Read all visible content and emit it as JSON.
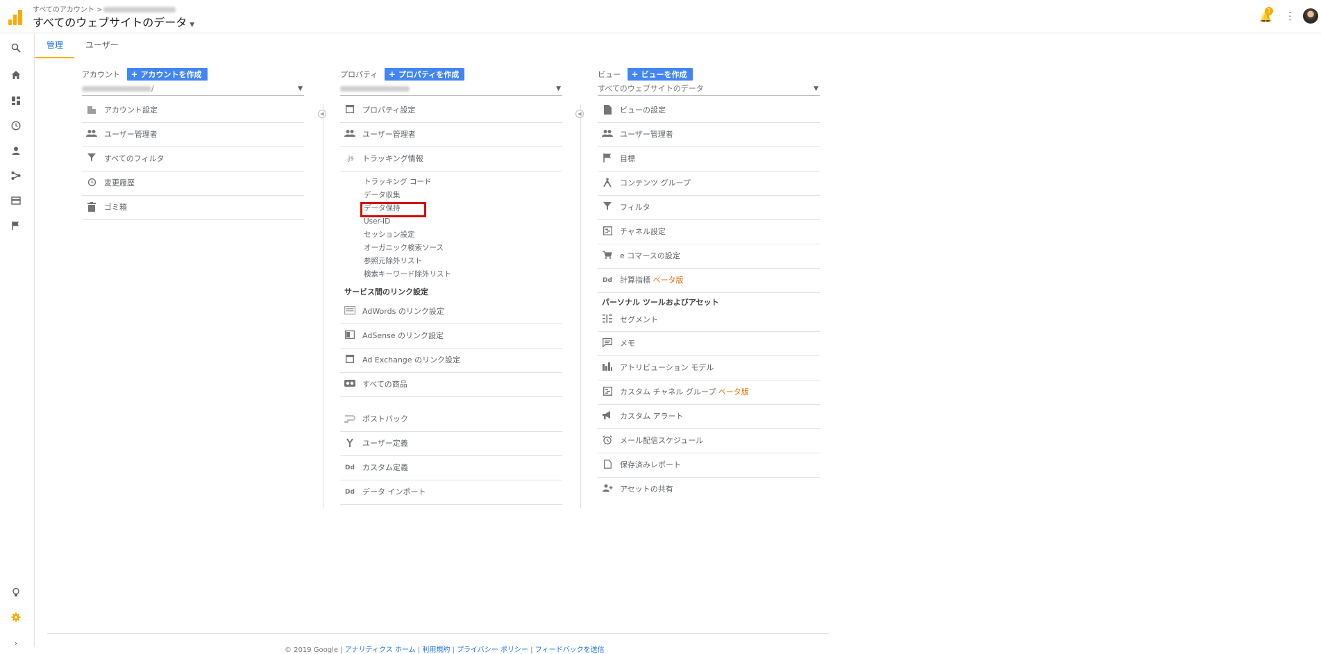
{
  "header": {
    "breadcrumb": "すべてのアカウント >",
    "view_title": "すべてのウェブサイトのデータ",
    "notification_count": "1"
  },
  "tabs": [
    {
      "label": "管理"
    },
    {
      "label": "ユーザー"
    }
  ],
  "account": {
    "heading": "アカウント",
    "create_label": "アカウントを作成",
    "selected_suffix": "/",
    "items": [
      {
        "label": "アカウント設定",
        "icon": "building-icon"
      },
      {
        "label": "ユーザー管理者",
        "icon": "people-icon"
      },
      {
        "label": "すべてのフィルタ",
        "icon": "filter-icon"
      },
      {
        "label": "変更履歴",
        "icon": "history-icon"
      },
      {
        "label": "ゴミ箱",
        "icon": "trash-icon"
      }
    ]
  },
  "property": {
    "heading": "プロパティ",
    "create_label": "プロパティを作成",
    "items": [
      {
        "label": "プロパティ設定",
        "icon": "square-icon"
      },
      {
        "label": "ユーザー管理者",
        "icon": "people-icon"
      },
      {
        "label": "トラッキング情報",
        "icon": "js-icon"
      }
    ],
    "tracking_subitems": [
      "トラッキング コード",
      "データ収集",
      "データ保持",
      "User-ID",
      "セッション設定",
      "オーガニック検索ソース",
      "参照元除外リスト",
      "検索キーワード除外リスト"
    ],
    "links_heading": "サービス間のリンク設定",
    "link_items": [
      {
        "label": "AdWords のリンク設定",
        "icon": "adwords-icon"
      },
      {
        "label": "AdSense のリンク設定",
        "icon": "adsense-icon"
      },
      {
        "label": "Ad Exchange のリンク設定",
        "icon": "adexchange-icon"
      },
      {
        "label": "すべての商品",
        "icon": "link-icon"
      }
    ],
    "extra_items": [
      {
        "label": "ポストバック",
        "icon": "postback-icon"
      },
      {
        "label": "ユーザー定義",
        "icon": "fork-icon"
      },
      {
        "label": "カスタム定義",
        "icon": "dd-icon"
      },
      {
        "label": "データ インポート",
        "icon": "dd-icon"
      }
    ]
  },
  "view": {
    "heading": "ビュー",
    "create_label": "ビューを作成",
    "selected": "すべてのウェブサイトのデータ",
    "items": [
      {
        "label": "ビューの設定",
        "icon": "file-icon"
      },
      {
        "label": "ユーザー管理者",
        "icon": "people-icon"
      },
      {
        "label": "目標",
        "icon": "flag-icon"
      },
      {
        "label": "コンテンツ グループ",
        "icon": "person-walk-icon"
      },
      {
        "label": "フィルタ",
        "icon": "filter-icon"
      },
      {
        "label": "チャネル設定",
        "icon": "channel-icon"
      },
      {
        "label": "e コマースの設定",
        "icon": "cart-icon"
      },
      {
        "label": "計算指標",
        "beta": "ベータ版",
        "icon": "dd-icon"
      }
    ],
    "personal_heading": "パーソナル ツールおよびアセット",
    "personal_items": [
      {
        "label": "セグメント",
        "icon": "segment-icon"
      },
      {
        "label": "メモ",
        "icon": "comment-icon"
      },
      {
        "label": "アトリビューション モデル",
        "icon": "bars-icon"
      },
      {
        "label": "カスタム チャネル グループ",
        "beta": "ベータ版",
        "icon": "channel-icon"
      },
      {
        "label": "カスタム アラート",
        "icon": "megaphone-icon"
      },
      {
        "label": "メール配信スケジュール",
        "icon": "alarm-icon"
      },
      {
        "label": "保存済みレポート",
        "icon": "doc-icon"
      },
      {
        "label": "アセットの共有",
        "icon": "person-add-icon"
      }
    ]
  },
  "footer": {
    "copyright": "© 2019 Google",
    "links": [
      "アナリティクス ホーム",
      "利用規約",
      "プライバシー ポリシー",
      "フィードバックを送信"
    ]
  },
  "colors": {
    "accent": "#f9ab00",
    "create_button": "#4285f4",
    "highlight": "#d10b0b",
    "beta": "#e8710a"
  }
}
